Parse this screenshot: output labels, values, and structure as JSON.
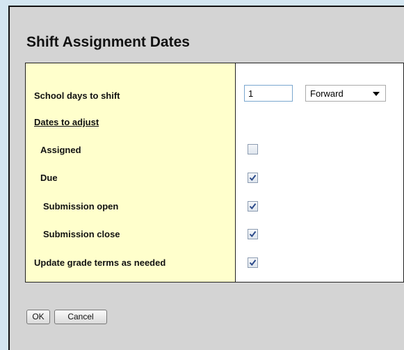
{
  "dialog": {
    "title": "Shift Assignment Dates"
  },
  "form": {
    "school_days_label": "School days to shift",
    "school_days_value": "1",
    "direction_value": "Forward",
    "dates_section_label": "Dates to adjust",
    "rows": [
      {
        "label": "Assigned",
        "checked": false
      },
      {
        "label": "Due",
        "checked": true
      },
      {
        "label": "Submission open",
        "checked": true
      },
      {
        "label": "Submission close",
        "checked": true
      },
      {
        "label": "Update grade terms as needed",
        "checked": true
      }
    ]
  },
  "buttons": {
    "ok_label": "OK",
    "cancel_label": "Cancel"
  },
  "colors": {
    "label_column_bg": "#ffffcc",
    "dialog_bg": "#d4d4d4",
    "page_bg": "#d4e6f1",
    "checkmark": "#2b4a8a"
  },
  "icons": {
    "select_arrow": "chevron-down-icon",
    "check": "checkmark-icon"
  }
}
